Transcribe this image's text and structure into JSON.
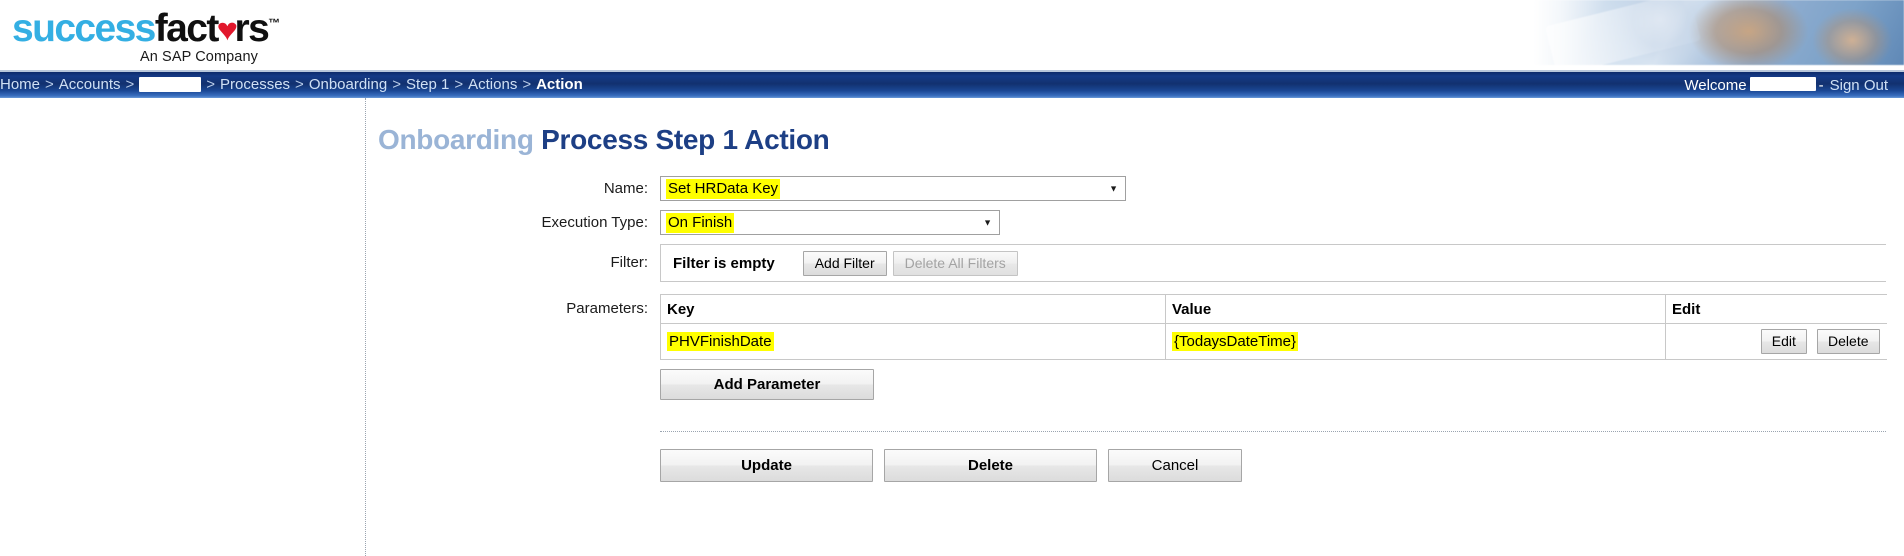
{
  "brand": {
    "name_part1": "success",
    "name_part2": "fact",
    "heart_icon": "heart-icon",
    "name_part3": "rs",
    "trademark": "™",
    "tagline": "An SAP Company",
    "color_success": "#34afe3",
    "color_fact": "#101010",
    "color_heart": "#e2172c"
  },
  "nav": {
    "breadcrumbs": [
      {
        "label": "Home",
        "current": false,
        "redacted": false
      },
      {
        "label": "Accounts",
        "current": false,
        "redacted": false
      },
      {
        "label": "",
        "current": false,
        "redacted": true
      },
      {
        "label": "Processes",
        "current": false,
        "redacted": false
      },
      {
        "label": "Onboarding",
        "current": false,
        "redacted": false
      },
      {
        "label": "Step 1",
        "current": false,
        "redacted": false
      },
      {
        "label": "Actions",
        "current": false,
        "redacted": false
      },
      {
        "label": "Action",
        "current": true,
        "redacted": false
      }
    ],
    "separator": ">",
    "welcome_label": "Welcome",
    "welcome_user_redacted": true,
    "welcome_dash": "-",
    "sign_out_label": "Sign Out",
    "bar_color": "#153a86"
  },
  "page": {
    "title_soft": "Onboarding",
    "title_main": "Process Step 1 Action",
    "title_color_soft": "#9ab4d6",
    "title_color_main": "#1d3f85"
  },
  "form": {
    "name": {
      "label": "Name:",
      "selected_value": "Set HRData Key",
      "highlighted": true,
      "dropdown_icon": "chevron-down-icon"
    },
    "execution_type": {
      "label": "Execution Type:",
      "selected_value": "On Finish",
      "highlighted": true,
      "dropdown_icon": "chevron-down-icon"
    },
    "filter": {
      "label": "Filter:",
      "status_text": "Filter is empty",
      "add_filter_label": "Add Filter",
      "delete_all_filters_label": "Delete All Filters",
      "delete_all_filters_disabled": true
    },
    "parameters": {
      "label": "Parameters:",
      "columns": [
        "Key",
        "Value",
        "Edit"
      ],
      "rows": [
        {
          "key": "PHVFinishDate",
          "value": "{TodaysDateTime}",
          "key_highlighted": true,
          "value_highlighted": true,
          "edit_label": "Edit",
          "delete_label": "Delete"
        }
      ],
      "add_parameter_label": "Add Parameter"
    }
  },
  "actions": {
    "update_label": "Update",
    "delete_label": "Delete",
    "cancel_label": "Cancel"
  },
  "highlight_color": "#ffff00"
}
